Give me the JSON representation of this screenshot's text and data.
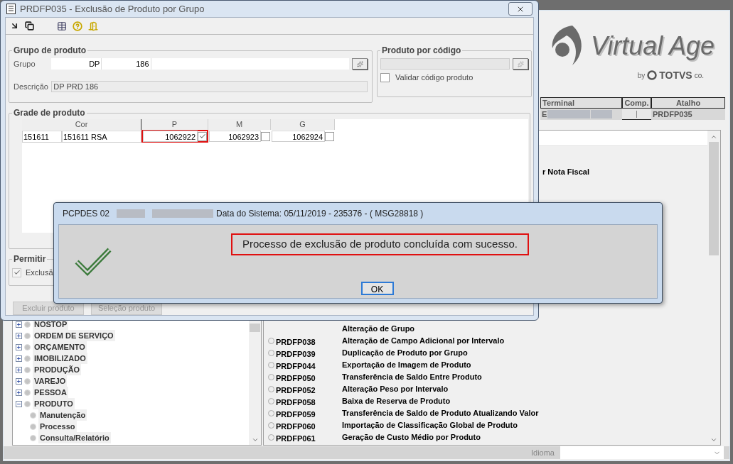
{
  "main_window": {
    "logo": {
      "brand": "Virtual Age",
      "by": "by",
      "company": "TOTVS",
      "company_suffix": "co."
    },
    "session_table": {
      "columns": [
        "Terminal",
        "Comp.",
        "Atalho"
      ],
      "terminal": "E",
      "shortcut": "PRDFP035"
    },
    "menu_tree": [
      {
        "label": "NOSTOP",
        "expanded": false
      },
      {
        "label": "ORDEM DE SERVIÇO",
        "expanded": false
      },
      {
        "label": "ORÇAMENTO",
        "expanded": false
      },
      {
        "label": "IMOBILIZADO",
        "expanded": false
      },
      {
        "label": "PRODUÇÃO",
        "expanded": false
      },
      {
        "label": "VAREJO",
        "expanded": false
      },
      {
        "label": "PESSOA",
        "expanded": false
      },
      {
        "label": "PRODUTO",
        "expanded": true,
        "children": [
          {
            "label": "Manutenção"
          },
          {
            "label": "Processo"
          },
          {
            "label": "Consulta/Relatório"
          }
        ]
      }
    ],
    "program_list": {
      "partial_text": "r Nota Fiscal",
      "rows": [
        {
          "description": "Alteração de Grupo"
        },
        {
          "code": "PRDFP038",
          "description": "Alteração de Campo Adicional por Intervalo"
        },
        {
          "code": "PRDFP039",
          "description": "Duplicação de Produto por Grupo"
        },
        {
          "code": "PRDFP044",
          "description": "Exportação de Imagem de Produto"
        },
        {
          "code": "PRDFP050",
          "description": "Transferência de Saldo Entre Produto"
        },
        {
          "code": "PRDFP052",
          "description": "Alteração Peso por Intervalo"
        },
        {
          "code": "PRDFP058",
          "description": "Baixa de Reserva de Produto"
        },
        {
          "code": "PRDFP059",
          "description": "Transferência de Saldo de Produto Atualizando Valor"
        },
        {
          "code": "PRDFP060",
          "description": "Importação de Classificação Global de Produto"
        },
        {
          "code": "PRDFP061",
          "description": "Geração de Custo Médio por Produto"
        }
      ]
    },
    "status_bar": {
      "language_label": "Idioma"
    }
  },
  "child_window": {
    "title": "PRDFP035 - Exclusão de Produto por Grupo",
    "product_group": {
      "title": "Grupo de produto",
      "group_label": "Grupo",
      "group_code": "DP",
      "group_number": "186",
      "description_label": "Descrição",
      "description": "DP PRD 186"
    },
    "product_by_code": {
      "title": "Produto por código",
      "validate_label": "Validar código produto",
      "validate_checked": false
    },
    "size_grid": {
      "title": "Grade de produto",
      "columns": [
        "Cor",
        "P",
        "M",
        "G"
      ],
      "rows": [
        {
          "color_code": "151611",
          "color_name": "151611 RSA",
          "sizes": [
            {
              "value": "1062922",
              "checked": true,
              "highlighted": true
            },
            {
              "value": "1062923",
              "checked": false,
              "highlighted": false
            },
            {
              "value": "1062924",
              "checked": false,
              "highlighted": false
            }
          ]
        }
      ]
    },
    "permit": {
      "title": "Permitir",
      "option_label": "Exclusã",
      "checked": true
    },
    "buttons": [
      {
        "label": "Excluir produto",
        "disabled": true
      },
      {
        "label": "Seleção produto",
        "disabled": true
      }
    ]
  },
  "message_dialog": {
    "title_prefix": "PCPDES 02",
    "title_info": "Data do Sistema: 05/11/2019 - 235376 - ( MSG28818 )",
    "message": "Processo de exclusão de produto concluída com sucesso.",
    "ok_label": "OK"
  }
}
